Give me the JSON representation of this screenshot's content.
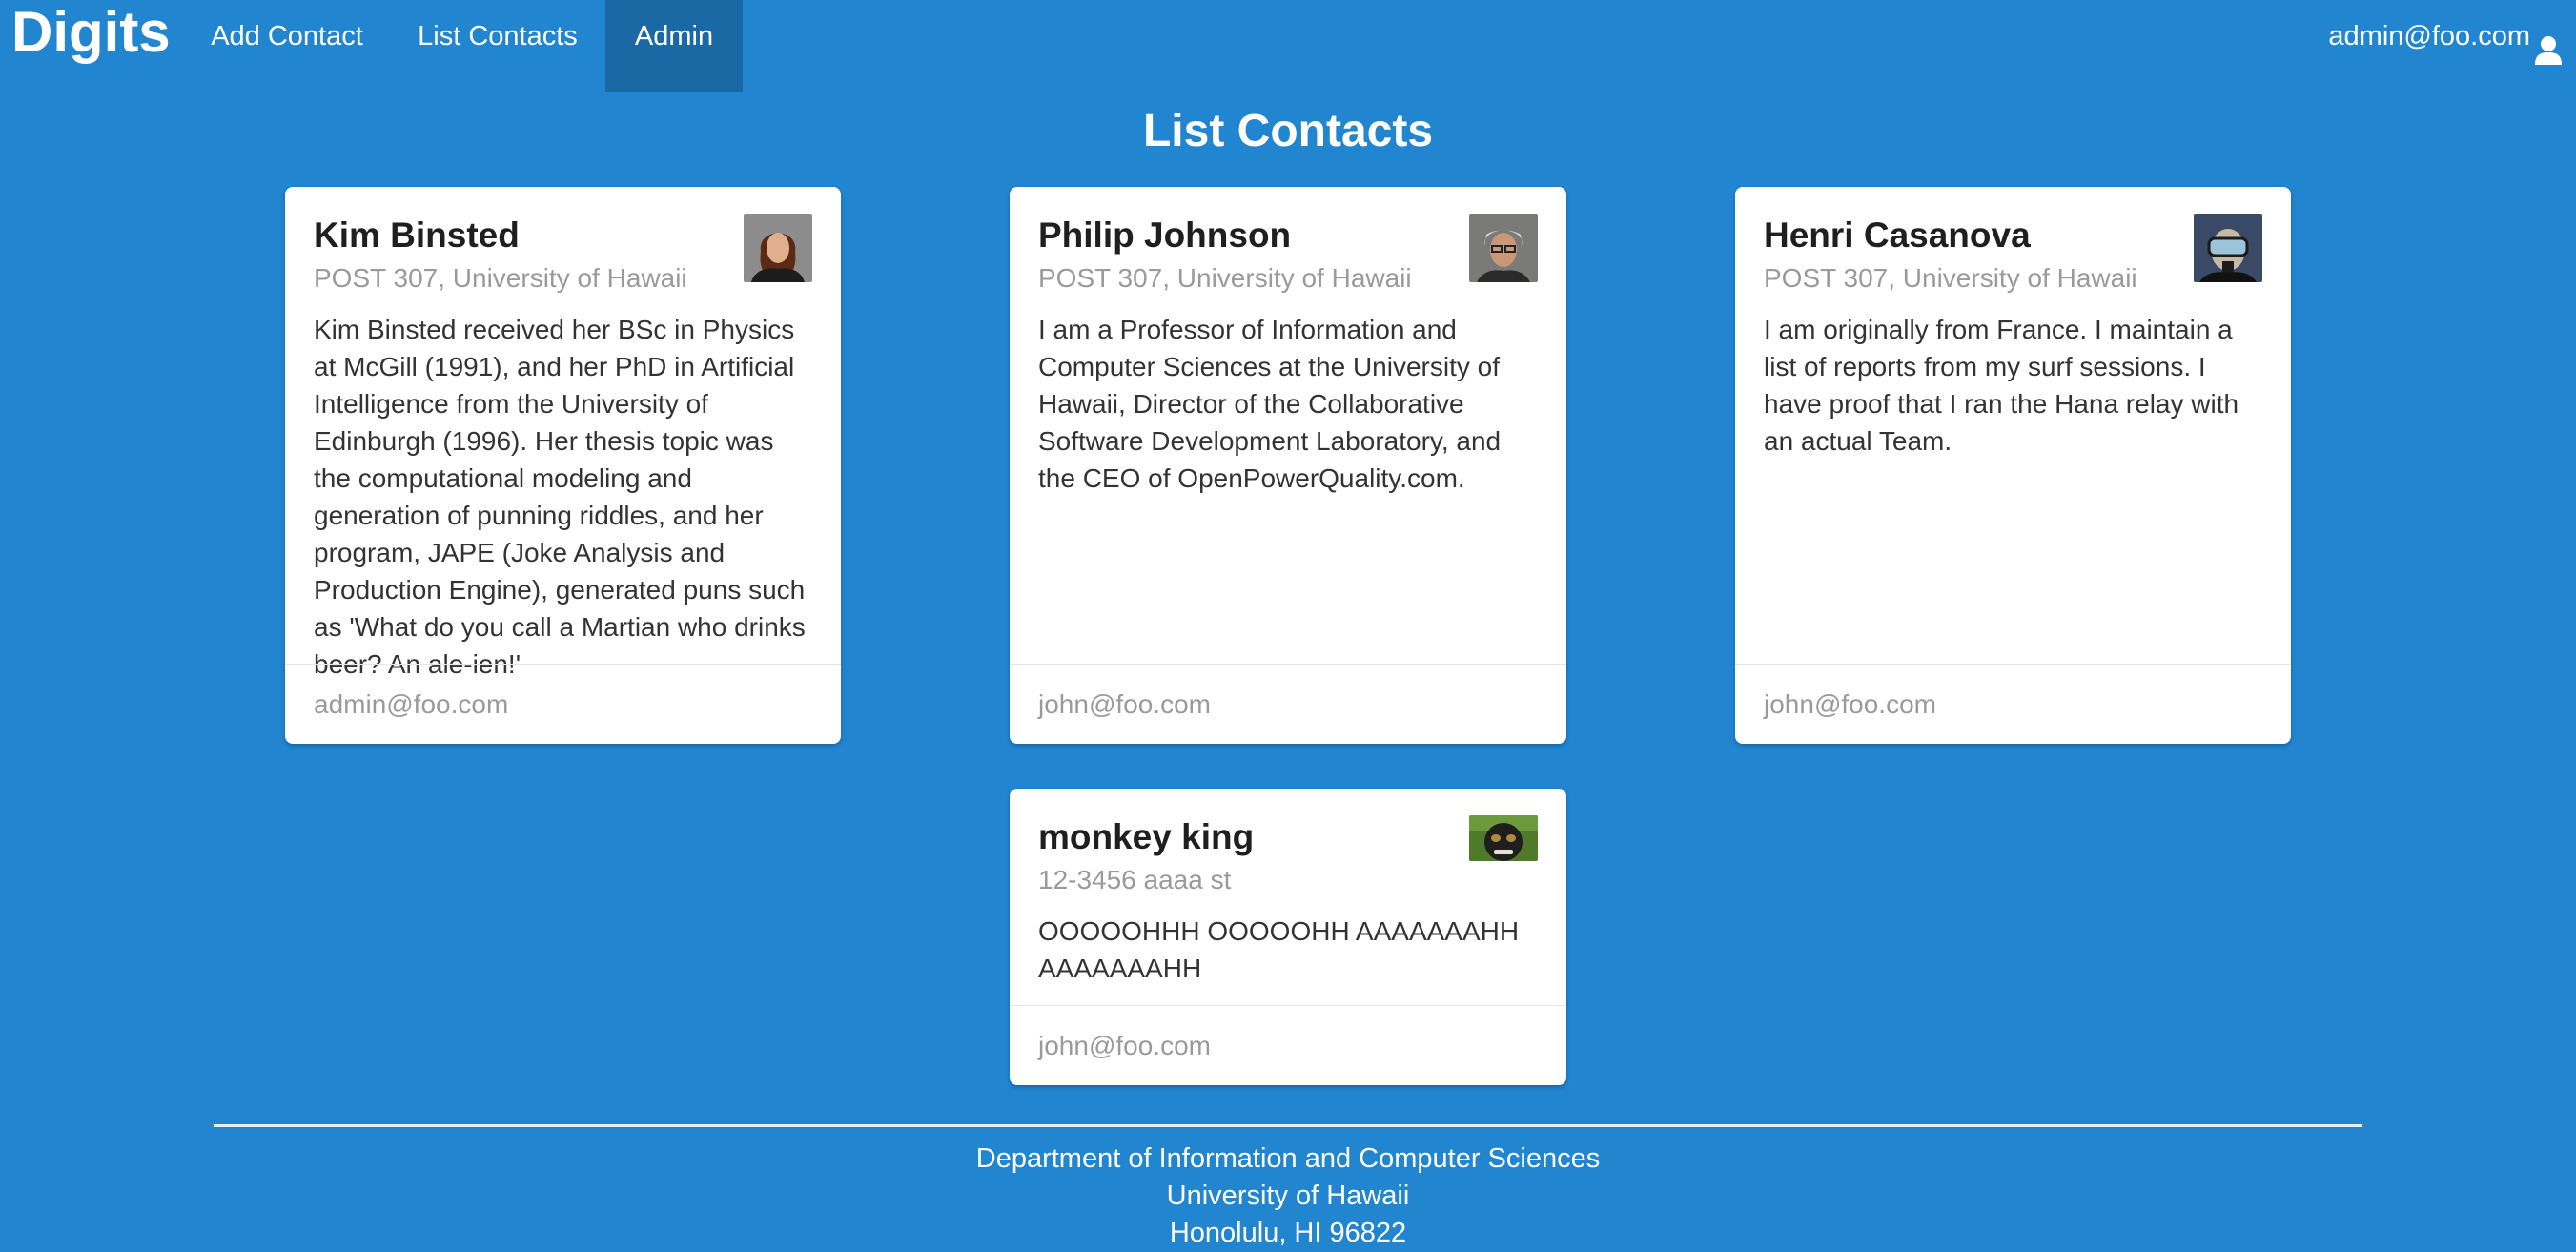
{
  "navbar": {
    "brand": "Digits",
    "items": [
      {
        "label": "Add Contact"
      },
      {
        "label": "List Contacts"
      },
      {
        "label": "Admin"
      }
    ],
    "user": "admin@foo.com",
    "user_icon": "user-icon"
  },
  "page": {
    "title": "List Contacts"
  },
  "contacts": [
    {
      "name": "Kim Binsted",
      "address": "POST 307, University of Hawaii",
      "description": "Kim Binsted received her BSc in Physics at McGill (1991), and her PhD in Artificial Intelligence from the University of Edinburgh (1996). Her thesis topic was the computational modeling and generation of punning riddles, and her program, JAPE (Joke Analysis and Production Engine), generated puns such as 'What do you call a Martian who drinks beer? An ale-ien!'",
      "owner": "admin@foo.com"
    },
    {
      "name": "Philip Johnson",
      "address": "POST 307, University of Hawaii",
      "description": "I am a Professor of Information and Computer Sciences at the University of Hawaii, Director of the Collaborative Software Development Laboratory, and the CEO of OpenPowerQuality.com.",
      "owner": "john@foo.com"
    },
    {
      "name": "Henri Casanova",
      "address": "POST 307, University of Hawaii",
      "description": "I am originally from France. I maintain a list of reports from my surf sessions. I have proof that I ran the Hana relay with an actual Team.",
      "owner": "john@foo.com"
    },
    {
      "name": "monkey king",
      "address": "12-3456 aaaa st",
      "description": "OOOOOHHH OOOOOHH AAAAAAAHH AAAAAAAHH",
      "owner": "john@foo.com"
    }
  ],
  "footer": {
    "line1": "Department of Information and Computer Sciences",
    "line2": "University of Hawaii",
    "line3": "Honolulu, HI 96822"
  },
  "colors": {
    "background": "#2185d0",
    "active_nav": "#1a69a4",
    "card": "#ffffff"
  }
}
